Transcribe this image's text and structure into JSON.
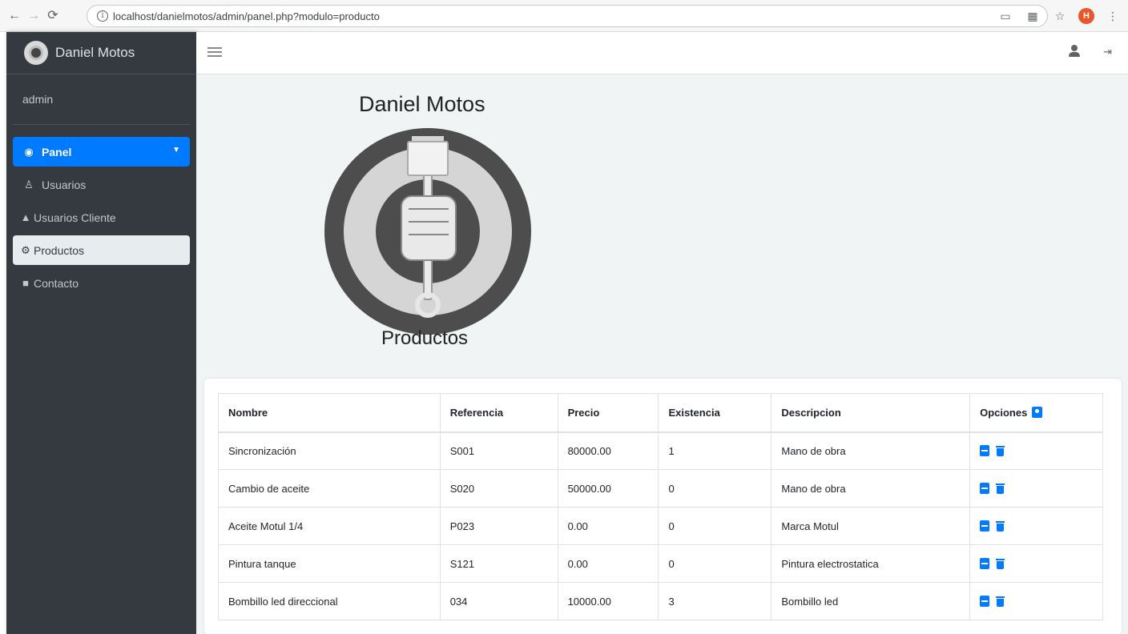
{
  "browser": {
    "url": "localhost/danielmotos/admin/panel.php?modulo=producto",
    "profile_initial": "H"
  },
  "sidebar": {
    "brand": "Daniel Motos",
    "user": "admin",
    "items": [
      {
        "label": "Panel",
        "icon": "tachometer-icon"
      },
      {
        "label": "Usuarios",
        "icon": "user-icon"
      },
      {
        "label": "Usuarios Cliente",
        "icon": "users-icon"
      },
      {
        "label": "Productos",
        "icon": "motorcycle-icon"
      },
      {
        "label": "Contacto",
        "icon": "address-book-icon"
      }
    ]
  },
  "header": {
    "title": "Daniel Motos",
    "caption": "Productos"
  },
  "table": {
    "columns": [
      "Nombre",
      "Referencia",
      "Precio",
      "Existencia",
      "Descripcion",
      "Opciones"
    ],
    "rows": [
      [
        "Sincronización",
        "S001",
        "80000.00",
        "1",
        "Mano de obra"
      ],
      [
        "Cambio de aceite",
        "S020",
        "50000.00",
        "0",
        "Mano de obra"
      ],
      [
        "Aceite Motul 1/4",
        "P023",
        "0.00",
        "0",
        "Marca Motul"
      ],
      [
        "Pintura tanque",
        "S121",
        "0.00",
        "0",
        "Pintura electrostatica"
      ],
      [
        "Bombillo led direccional",
        "034",
        "10000.00",
        "3",
        "Bombillo led"
      ]
    ]
  },
  "colors": {
    "sidebar_bg": "#343a40",
    "accent": "#007bff",
    "content_bg": "#f0f4f4"
  }
}
